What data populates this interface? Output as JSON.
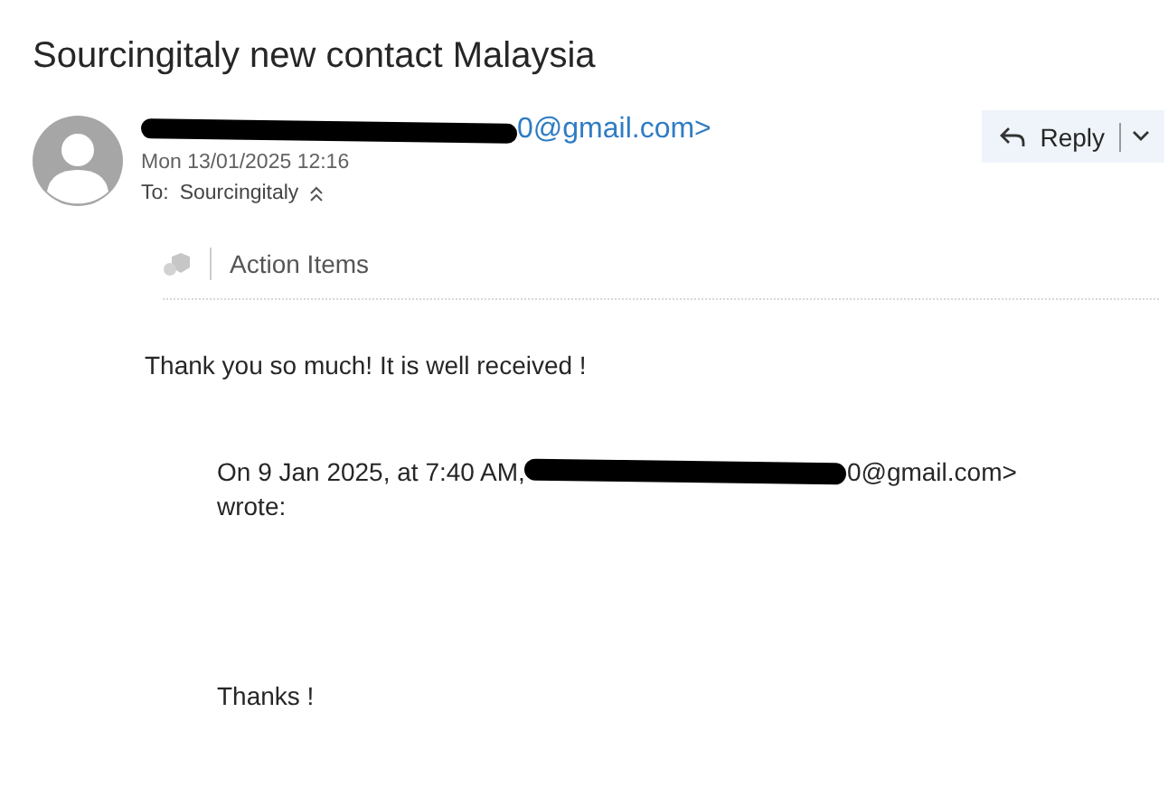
{
  "subject": "Sourcingitaly new contact Malaysia",
  "sender": {
    "address_visible": "0@gmail.com>",
    "date": "Mon 13/01/2025 12:16",
    "to_label": "To:",
    "to": "Sourcingitaly"
  },
  "reply_button": {
    "label": "Reply"
  },
  "action_items": {
    "label": "Action Items"
  },
  "body": [
    {
      "kind": "text",
      "text": "Thank you so much! It is well received !"
    },
    {
      "kind": "quote",
      "prefix": "On 9 Jan 2025, at 7:40 AM,",
      "address_visible": "0@gmail.com>",
      "suffix": "wrote:"
    },
    {
      "kind": "indented",
      "text": "Thanks !"
    }
  ]
}
